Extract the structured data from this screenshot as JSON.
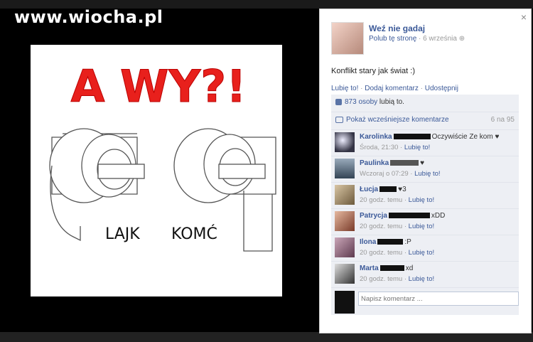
{
  "watermark": "www.wiocha.pl",
  "topbar_ghost": "",
  "meme": {
    "headline": "A WY?!",
    "left_label": "LAJK",
    "right_label": "KOMĆ"
  },
  "bottomstrip_text": "",
  "post": {
    "page_name": "Weź nie gadaj",
    "like_page": "Polub tę stronę",
    "date": "6 września",
    "text": "Konflikt stary jak świat :)",
    "actions": [
      "Lubię to!",
      "Dodaj komentarz",
      "Udostępnij"
    ],
    "likes_count": "873 osoby",
    "likes_suffix": " lubią to.",
    "prev_comments": "Pokaż wcześniejsze komentarze",
    "prev_count": "6 na 95",
    "close": "×"
  },
  "comments": [
    {
      "name": "Karolinka",
      "text": "Oczywiście Ze kom ♥",
      "time": "Środa, 21:30",
      "like": "Lubię to!"
    },
    {
      "name": "Paulinka",
      "text": "♥",
      "time": "Wczoraj o 07:29",
      "like": "Lubię to!"
    },
    {
      "name": "Łucja",
      "text": "♥3",
      "time": "20 godz. temu",
      "like": "Lubię to!"
    },
    {
      "name": "Patrycja",
      "text": "xDD",
      "time": "20 godz. temu",
      "like": "Lubię to!"
    },
    {
      "name": "Ilona",
      "text": ":P",
      "time": "20 godz. temu",
      "like": "Lubię to!"
    },
    {
      "name": "Marta",
      "text": "xd",
      "time": "20 godz. temu",
      "like": "Lubię to!"
    }
  ],
  "comment_input": {
    "placeholder": "Napisz komentarz ..."
  }
}
